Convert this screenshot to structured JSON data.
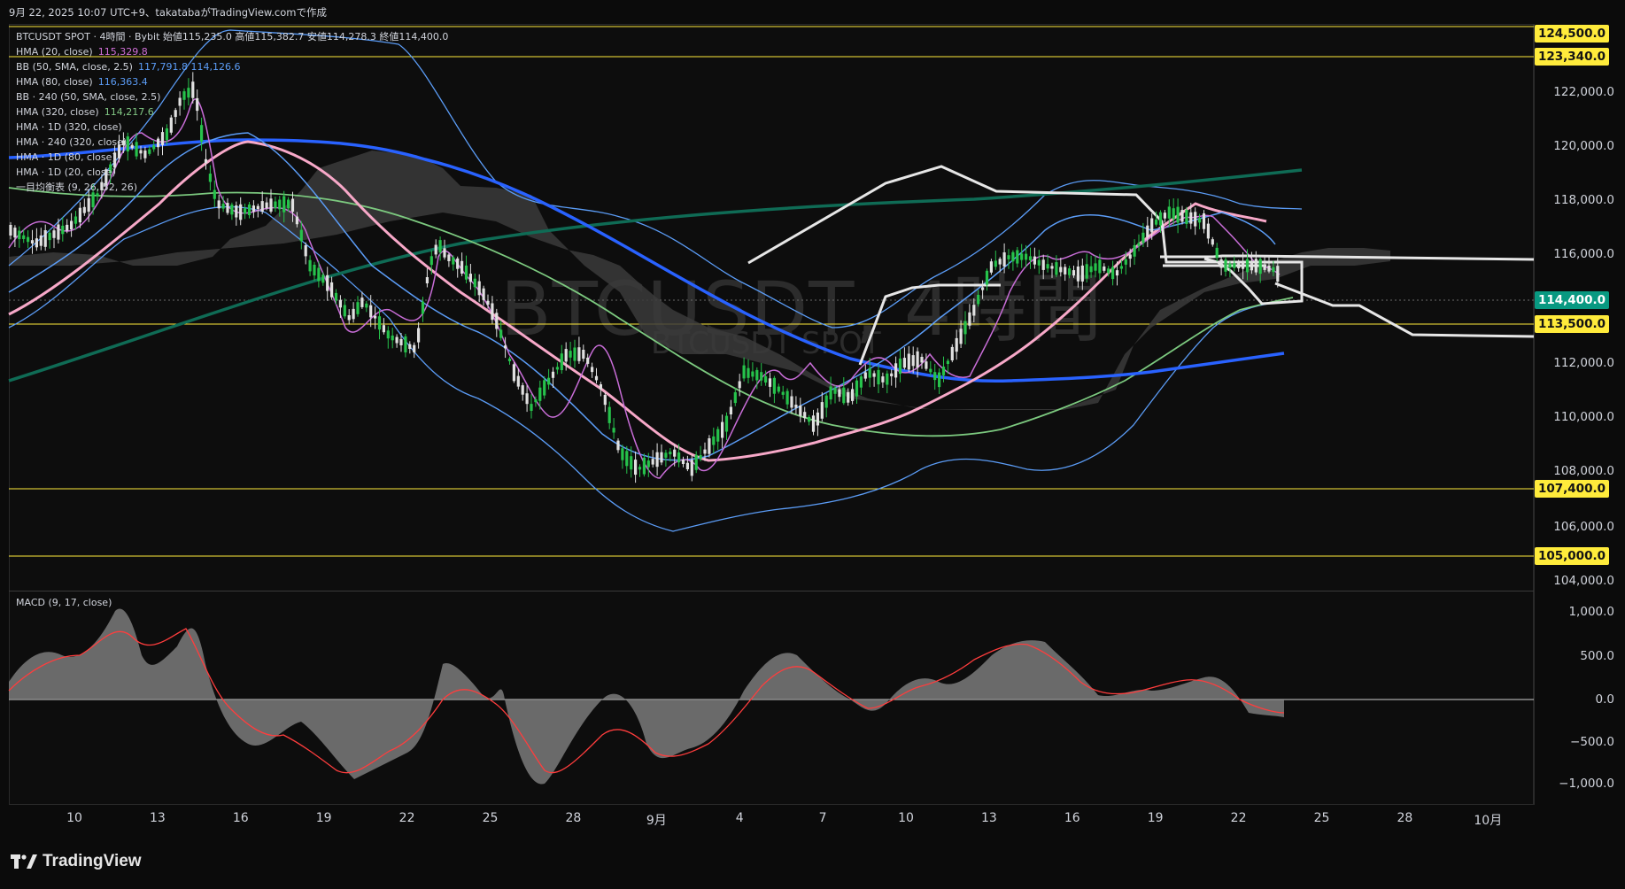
{
  "header": {
    "caption": "9月 22, 2025 10:07 UTC+9、takatabaがTradingView.comで作成"
  },
  "legend": {
    "rows": [
      {
        "label": "BTCUSDT SPOT · 4時間 · Bybit  始値115,235.0  高値115,382.7  安値114,278.3  終値114,400.0",
        "value": "",
        "color": "#d1d4dc"
      },
      {
        "label": "HMA (20, close)",
        "value": "115,329.8",
        "color": "#d06fd7"
      },
      {
        "label": "BB (50, SMA, close, 2.5)",
        "value": "117,791.8  114,126.6",
        "color": "#5b9cf6"
      },
      {
        "label": "HMA (80, close)",
        "value": "116,363.4",
        "color": "#5b9cf6"
      },
      {
        "label": "BB · 240 (50, SMA, close, 2.5)",
        "value": "",
        "color": "#d1d4dc"
      },
      {
        "label": "HMA (320, close)",
        "value": "114,217.6",
        "color": "#81c784"
      },
      {
        "label": "HMA · 1D (320, close)",
        "value": "",
        "color": "#d1d4dc"
      },
      {
        "label": "HMA · 240 (320, close)",
        "value": "",
        "color": "#d1d4dc"
      },
      {
        "label": "HMA · 1D (80, close)",
        "value": "",
        "color": "#d1d4dc"
      },
      {
        "label": "HMA · 1D (20, close)",
        "value": "",
        "color": "#d1d4dc"
      },
      {
        "label": "一目均衡表 (9, 26, 52, 26)",
        "value": "",
        "color": "#d1d4dc"
      }
    ],
    "macd": "MACD (9, 17, close)"
  },
  "watermark": {
    "symbol": "BTCUSDT, 4時間",
    "sub": "BTCUSDT SPOT"
  },
  "price_axis": {
    "ticks": [
      "122,000.0",
      "120,000.0",
      "118,000.0",
      "116,000.0",
      "112,000.0",
      "110,000.0",
      "108,000.0",
      "106,000.0",
      "104,000.0"
    ],
    "badges": [
      {
        "text": "124,500.0",
        "kind": "yellow"
      },
      {
        "text": "123,340.0",
        "kind": "yellow"
      },
      {
        "text": "114,400.0",
        "kind": "green"
      },
      {
        "text": "113,500.0",
        "kind": "yellow"
      },
      {
        "text": "107,400.0",
        "kind": "yellow"
      },
      {
        "text": "105,000.0",
        "kind": "yellow"
      }
    ],
    "macd_ticks": [
      "1,000.0",
      "500.0",
      "0.0",
      "−500.0",
      "−1,000.0"
    ]
  },
  "time_axis": [
    "10",
    "13",
    "16",
    "19",
    "22",
    "25",
    "28",
    "9月",
    "4",
    "7",
    "10",
    "13",
    "16",
    "19",
    "22",
    "25",
    "28",
    "10月"
  ],
  "colors": {
    "bull": "#26c24b",
    "bear": "#e0e0e0",
    "hma20": "#c86dd7",
    "hma80": "#5b9cf6",
    "hma320": "#7cc97f",
    "hma1d80": "#2962ff",
    "hma1d20": "#f7a8c8",
    "hma1d320": "#0f6b55",
    "cloud": "#3a3a3a",
    "level": "#ffeb3b",
    "macd": "#8a8a8a",
    "signal": "#ff3d3d"
  },
  "brand": "TradingView"
}
